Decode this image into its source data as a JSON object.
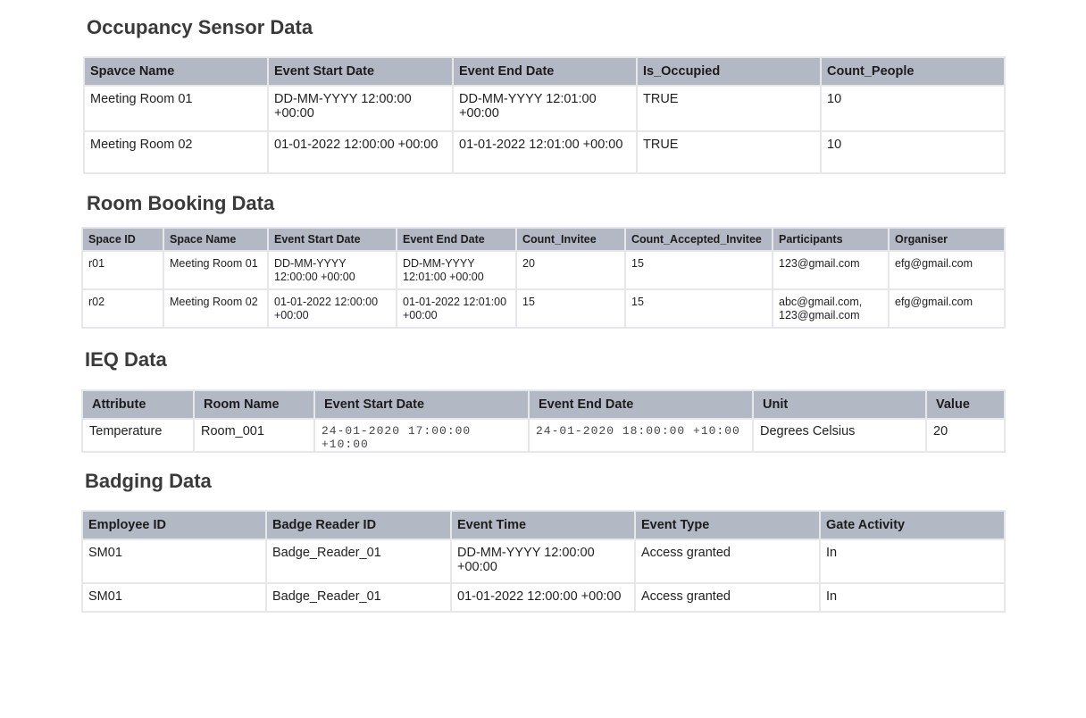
{
  "occupancy": {
    "title": "Occupancy Sensor Data",
    "headers": [
      "Spavce Name",
      "Event Start Date",
      "Event End Date",
      "Is_Occupied",
      "Count_People"
    ],
    "rows": [
      [
        "Meeting Room 01",
        "DD-MM-YYYY 12:00:00 +00:00",
        "DD-MM-YYYY 12:01:00 +00:00",
        "TRUE",
        "10"
      ],
      [
        "Meeting Room 02",
        "01-01-2022 12:00:00 +00:00",
        "01-01-2022 12:01:00 +00:00",
        "TRUE",
        "10"
      ]
    ]
  },
  "room_booking": {
    "title": "Room Booking Data",
    "headers": [
      "Space ID",
      "Space Name",
      "Event Start Date",
      "Event End Date",
      "Count_Invitee",
      "Count_Accepted_Invitee",
      "Participants",
      "Organiser"
    ],
    "rows": [
      [
        "r01",
        "Meeting Room 01",
        "DD-MM-YYYY 12:00:00 +00:00",
        "DD-MM-YYYY 12:01:00 +00:00",
        "20",
        "15",
        "123@gmail.com",
        "efg@gmail.com"
      ],
      [
        "r02",
        "Meeting Room 02",
        "01-01-2022 12:00:00 +00:00",
        "01-01-2022 12:01:00 +00:00",
        "15",
        "15",
        "abc@gmail.com, 123@gmail.com",
        "efg@gmail.com"
      ]
    ]
  },
  "ieq": {
    "title": "IEQ Data",
    "headers": [
      "Attribute",
      "Room Name",
      "Event Start Date",
      "Event End Date",
      "Unit",
      "Value"
    ],
    "rows": [
      [
        "Temperature",
        "Room_001",
        "24-01-2020 17:00:00 +10:00",
        "24-01-2020 18:00:00 +10:00",
        "Degrees Celsius",
        "20"
      ]
    ]
  },
  "badging": {
    "title": "Badging Data",
    "headers": [
      "Employee ID",
      "Badge Reader ID",
      "Event Time",
      "Event Type",
      "Gate Activity"
    ],
    "rows": [
      [
        "SM01",
        "Badge_Reader_01",
        "DD-MM-YYYY 12:00:00 +00:00",
        "Access granted",
        "In"
      ],
      [
        "SM01",
        "Badge_Reader_01",
        "01-01-2022 12:00:00 +00:00",
        "Access granted",
        "In"
      ]
    ]
  }
}
